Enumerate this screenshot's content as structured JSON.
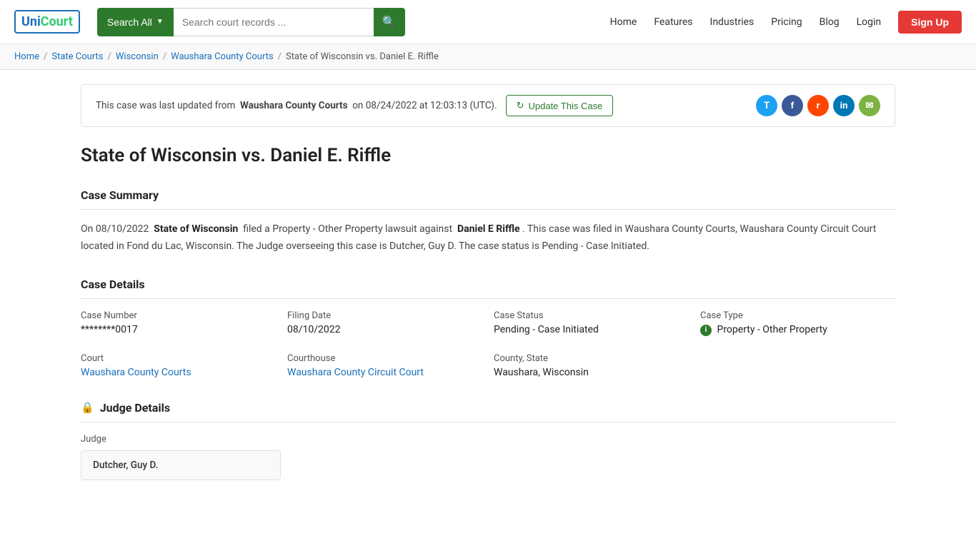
{
  "logo": {
    "text_uni": "Uni",
    "text_court": "Court"
  },
  "header": {
    "search_all_label": "Search All",
    "search_placeholder": "Search court records ...",
    "nav_items": [
      "Home",
      "Features",
      "Industries",
      "Pricing",
      "Blog",
      "Login"
    ],
    "signup_label": "Sign Up"
  },
  "breadcrumb": {
    "items": [
      {
        "label": "Home",
        "href": "#"
      },
      {
        "label": "State Courts",
        "href": "#"
      },
      {
        "label": "Wisconsin",
        "href": "#"
      },
      {
        "label": "Waushara County Courts",
        "href": "#"
      }
    ],
    "current": "State of Wisconsin vs. Daniel E. Riffle"
  },
  "update_notice": {
    "text_prefix": "This case was last updated from",
    "court_name": "Waushara County Courts",
    "text_suffix": "on 08/24/2022 at 12:03:13 (UTC).",
    "button_label": "Update This Case"
  },
  "social": {
    "icons": [
      "T",
      "f",
      "r",
      "in",
      "✉"
    ]
  },
  "case": {
    "title": "State of Wisconsin vs. Daniel E. Riffle",
    "summary_section_label": "Case Summary",
    "summary_text_prefix": "On 08/10/2022",
    "plaintiff": "State of Wisconsin",
    "summary_text_mid": "filed a Property - Other Property lawsuit against",
    "defendant": "Daniel E Riffle",
    "summary_text_suffix": ". This case was filed in Waushara County Courts, Waushara County Circuit Court located in Fond du Lac, Wisconsin. The Judge overseeing this case is Dutcher, Guy D. The case status is Pending - Case Initiated.",
    "details_section_label": "Case Details",
    "fields": {
      "case_number_label": "Case Number",
      "case_number_value": "********0017",
      "filing_date_label": "Filing Date",
      "filing_date_value": "08/10/2022",
      "case_status_label": "Case Status",
      "case_status_value": "Pending - Case Initiated",
      "case_type_label": "Case Type",
      "case_type_value": "Property - Other Property",
      "court_label": "Court",
      "court_value": "Waushara County Courts",
      "courthouse_label": "Courthouse",
      "courthouse_value": "Waushara County Circuit Court",
      "county_state_label": "County, State",
      "county_state_value": "Waushara, Wisconsin"
    },
    "judge_section_label": "Judge Details",
    "judge_label": "Judge",
    "judge_name": "Dutcher, Guy D."
  }
}
